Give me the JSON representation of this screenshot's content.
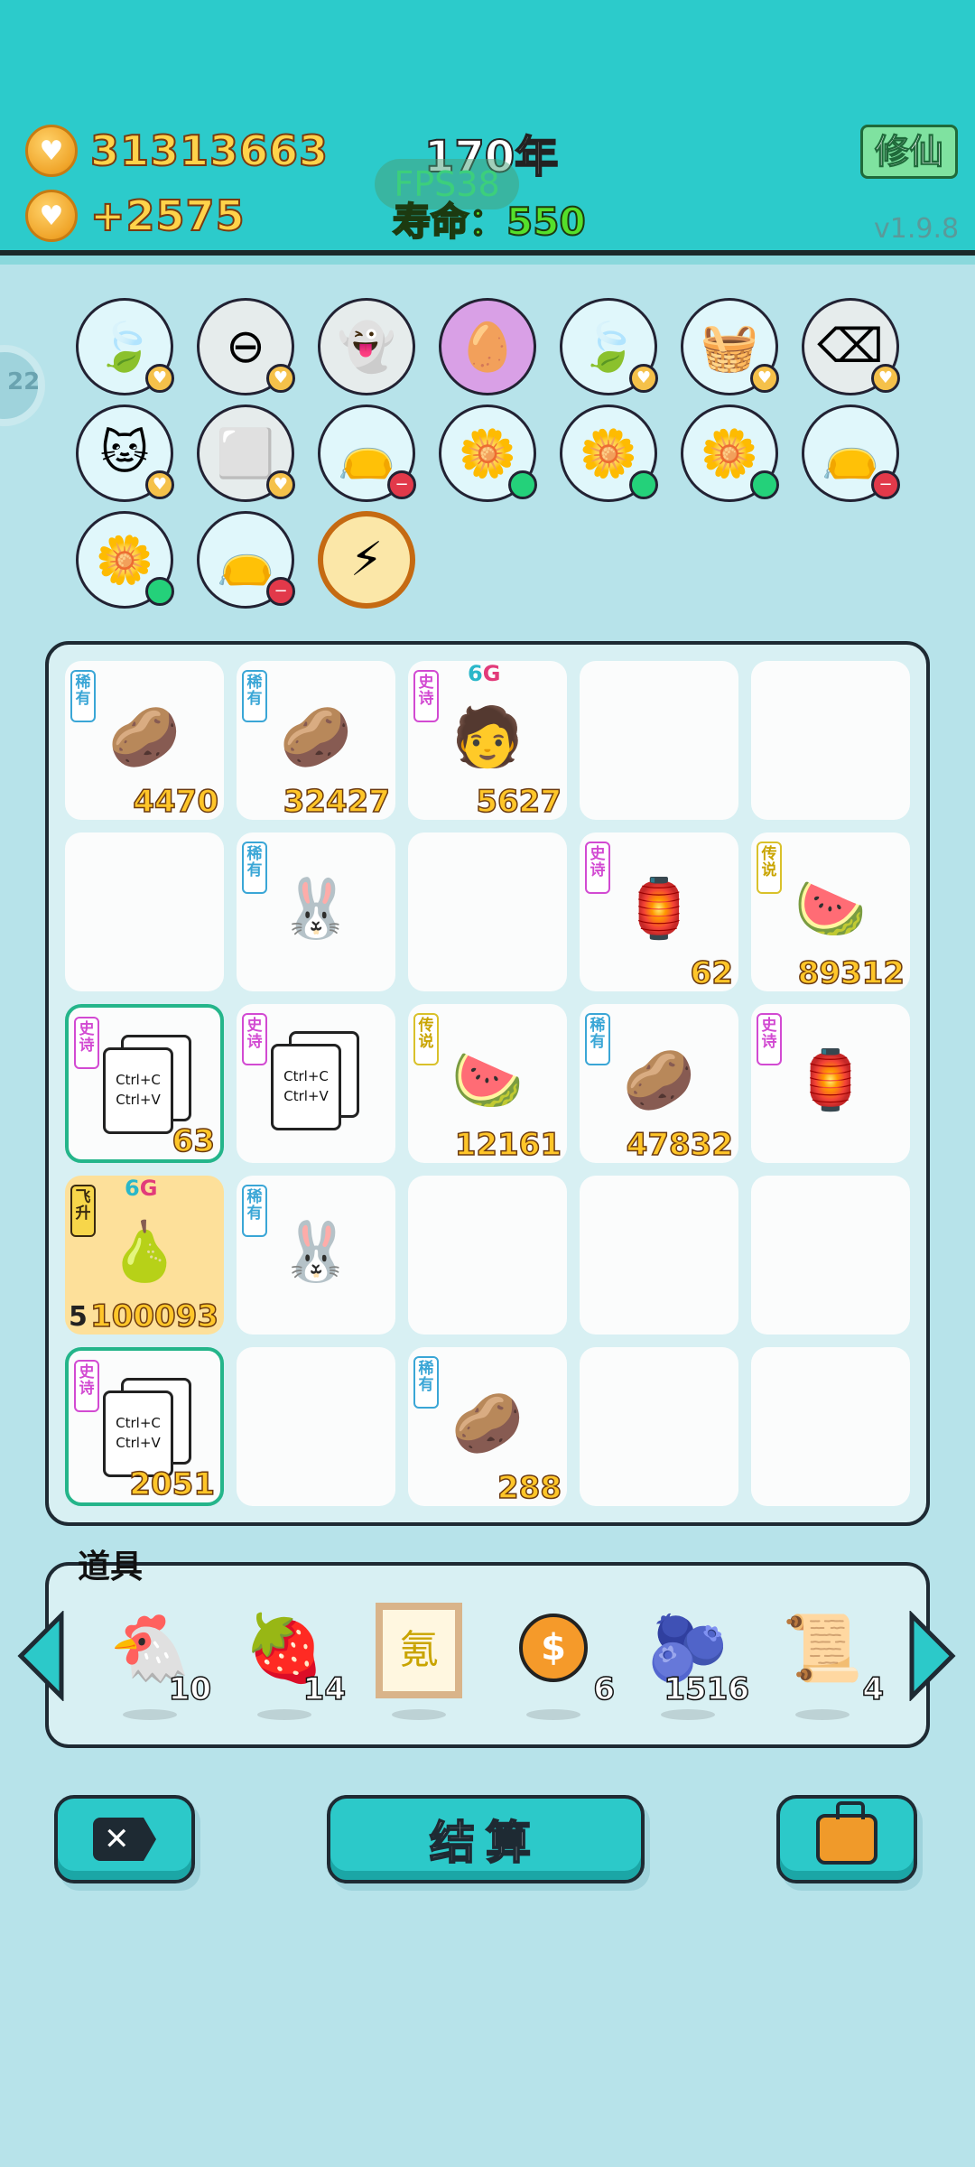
{
  "header": {
    "coins": "31313663",
    "coin_rate": "+2575",
    "year": "170年",
    "fps": "FPS38",
    "lifespan": "寿命：550",
    "xiuxian_label": "修仙",
    "version": "v1.9.8"
  },
  "side_indicator": "22",
  "buffs": [
    {
      "name": "leaf-icon",
      "glyph": "🍃",
      "bg": "#e0f7fb",
      "badge": "heart"
    },
    {
      "name": "no-entry-icon",
      "glyph": "⊖",
      "bg": "#e6ecec",
      "badge": "heart"
    },
    {
      "name": "ghost-icon",
      "glyph": "👻",
      "bg": "#e6ecec",
      "badge": ""
    },
    {
      "name": "egg-icon",
      "glyph": "🥚",
      "bg": "#d9a0e6",
      "badge": ""
    },
    {
      "name": "leaf-icon",
      "glyph": "🍃",
      "bg": "#e0f7fb",
      "badge": "heart"
    },
    {
      "name": "fruit-basket-icon",
      "glyph": "🧺",
      "bg": "#e0f7fb",
      "badge": "heart"
    },
    {
      "name": "delete-tag-icon",
      "glyph": "⌫",
      "bg": "#e6ecec",
      "badge": "heart"
    },
    {
      "name": "cat-icon",
      "glyph": "🐱",
      "bg": "#e0f7fb",
      "badge": "heart"
    },
    {
      "name": "tofu-icon",
      "glyph": "⬜",
      "bg": "#e6ecec",
      "badge": "heart"
    },
    {
      "name": "sack-icon",
      "glyph": "👝",
      "bg": "#e0f7fb",
      "badge": "red"
    },
    {
      "name": "flower-pot-icon",
      "glyph": "🌼",
      "bg": "#e0f7fb",
      "badge": "green"
    },
    {
      "name": "flower-pot-icon",
      "glyph": "🌼",
      "bg": "#e0f7fb",
      "badge": "green"
    },
    {
      "name": "flower-pot-icon",
      "glyph": "🌼",
      "bg": "#e0f7fb",
      "badge": "green"
    },
    {
      "name": "sack-icon",
      "glyph": "👝",
      "bg": "#e0f7fb",
      "badge": "red"
    },
    {
      "name": "flower-pot-icon",
      "glyph": "🌼",
      "bg": "#e0f7fb",
      "badge": "green"
    },
    {
      "name": "sack-icon",
      "glyph": "👝",
      "bg": "#e0f7fb",
      "badge": "red"
    },
    {
      "name": "lightning-icon",
      "glyph": "⚡",
      "bg": "#fbe7a8",
      "badge": ""
    }
  ],
  "grid": [
    {
      "tag": "稀有",
      "tag_type": "rare",
      "item": "potato",
      "glyph": "🥔",
      "count": "4470"
    },
    {
      "tag": "稀有",
      "tag_type": "rare",
      "item": "potato",
      "glyph": "🥔",
      "count": "32427"
    },
    {
      "tag": "史诗",
      "tag_type": "epic",
      "item": "face",
      "glyph": "🧑",
      "count": "5627",
      "sixg": true
    },
    {},
    {},
    {},
    {
      "tag": "稀有",
      "tag_type": "rare",
      "item": "rabbit",
      "glyph": "🐰",
      "count": ""
    },
    {},
    {
      "tag": "史诗",
      "tag_type": "epic",
      "item": "rabbit-house",
      "glyph": "🏮",
      "count": "62"
    },
    {
      "tag": "传说",
      "tag_type": "legend",
      "item": "watermelon",
      "glyph": "🍉",
      "count": "89312"
    },
    {
      "tag": "史诗",
      "tag_type": "epic",
      "item": "copy-paste",
      "glyph": "",
      "count": "63",
      "selected": true,
      "copy": true
    },
    {
      "tag": "史诗",
      "tag_type": "epic",
      "item": "copy-paste",
      "glyph": "",
      "count": "",
      "copy": true
    },
    {
      "tag": "传说",
      "tag_type": "legend",
      "item": "watermelon",
      "glyph": "🍉",
      "count": "12161"
    },
    {
      "tag": "稀有",
      "tag_type": "rare",
      "item": "potato",
      "glyph": "🥔",
      "count": "47832"
    },
    {
      "tag": "史诗",
      "tag_type": "epic",
      "item": "rabbit-house",
      "glyph": "🏮",
      "count": ""
    },
    {
      "tag": "飞升",
      "tag_type": "fly",
      "item": "golden-pears",
      "glyph": "🍐",
      "count": "100093",
      "gold": true,
      "sixg": true,
      "level": "5"
    },
    {
      "tag": "稀有",
      "tag_type": "rare",
      "item": "rabbit",
      "glyph": "🐰",
      "count": ""
    },
    {},
    {},
    {},
    {
      "tag": "史诗",
      "tag_type": "epic",
      "item": "copy-paste",
      "glyph": "",
      "count": "2051",
      "selected": true,
      "copy": true
    },
    {},
    {
      "tag": "稀有",
      "tag_type": "rare",
      "item": "potato",
      "glyph": "🥔",
      "count": "288"
    },
    {},
    {}
  ],
  "copy_text": {
    "line1": "Ctrl+C",
    "line2": "Ctrl+V"
  },
  "sixg": {
    "six": "6",
    "g": "G"
  },
  "props": {
    "title": "道具",
    "items": [
      {
        "name": "chicken-icon",
        "glyph": "🐔",
        "count": "10"
      },
      {
        "name": "strawberry-icon",
        "glyph": "🍓",
        "count": "14"
      },
      {
        "name": "scroll-frame-icon",
        "glyph": "氪",
        "count": ""
      },
      {
        "name": "coin-icon",
        "glyph": "$",
        "count": "6"
      },
      {
        "name": "blueberry-icon",
        "glyph": "🫐",
        "count": "1516"
      },
      {
        "name": "legend-cards-icon",
        "glyph": "📜",
        "count": "4"
      }
    ]
  },
  "bottom": {
    "settle_label": "结算"
  }
}
